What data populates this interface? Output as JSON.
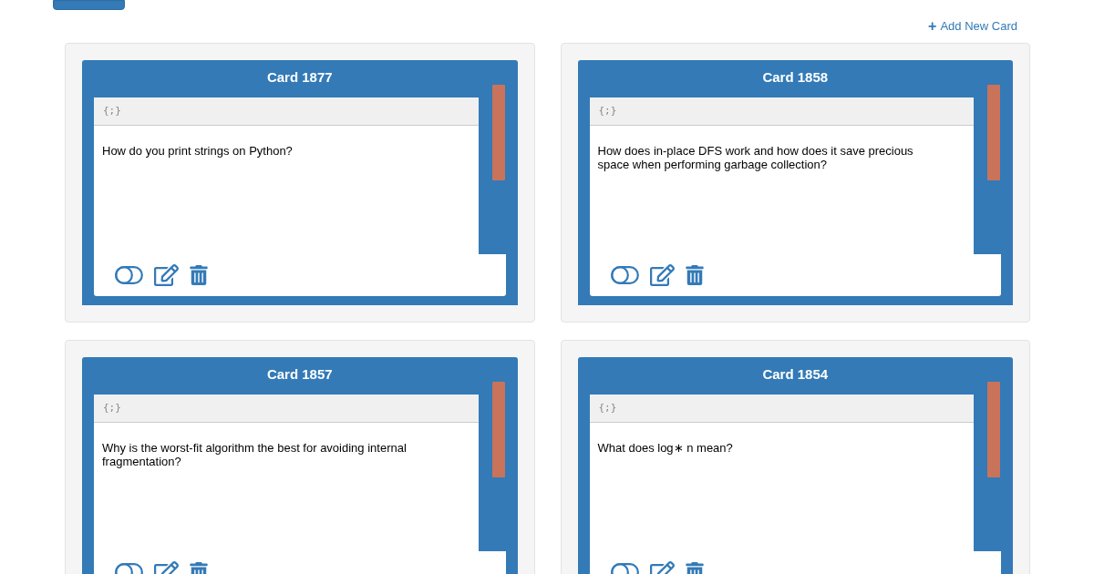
{
  "add_link": {
    "icon": "+",
    "label": "Add New Card"
  },
  "cards": [
    {
      "title": "Card 1877",
      "toolbar_label": "{;}",
      "question": "How do you print strings on Python?"
    },
    {
      "title": "Card 1858",
      "toolbar_label": "{;}",
      "question": "How does in-place DFS work and how does it save precious space when performing garbage collection?"
    },
    {
      "title": "Card 1857",
      "toolbar_label": "{;}",
      "question": "Why is the worst-fit algorithm the best for avoiding internal fragmentation?"
    },
    {
      "title": "Card 1854",
      "toolbar_label": "{;}",
      "question": "What does log∗ n mean?"
    }
  ]
}
